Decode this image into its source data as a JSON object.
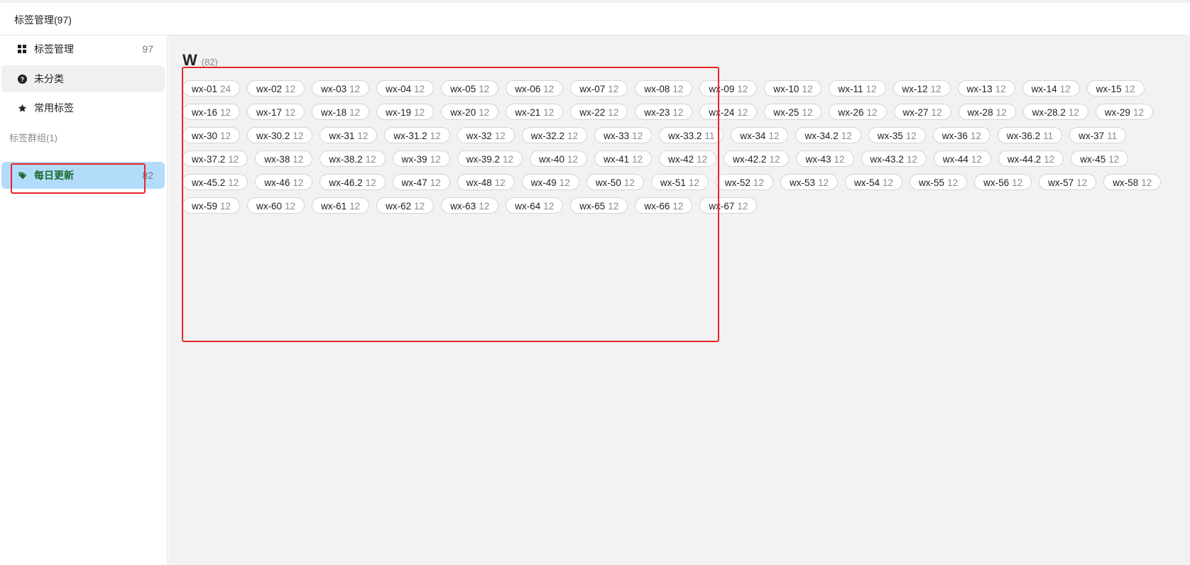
{
  "window": {
    "title": "标签管理(97)"
  },
  "sidebar": {
    "items": [
      {
        "label": "标签管理",
        "count": "97",
        "icon": "grid-icon"
      },
      {
        "label": "未分类",
        "count": "",
        "icon": "question-circle-icon"
      },
      {
        "label": "常用标签",
        "count": "",
        "icon": "star-icon"
      }
    ],
    "section_label": "标签群组(1)",
    "groups": [
      {
        "label": "每日更新",
        "count": "82",
        "icon": "tags-icon"
      }
    ]
  },
  "main": {
    "group_letter": "W",
    "group_count": "(82)",
    "tags": [
      {
        "name": "wx-01",
        "count": "24"
      },
      {
        "name": "wx-02",
        "count": "12"
      },
      {
        "name": "wx-03",
        "count": "12"
      },
      {
        "name": "wx-04",
        "count": "12"
      },
      {
        "name": "wx-05",
        "count": "12"
      },
      {
        "name": "wx-06",
        "count": "12"
      },
      {
        "name": "wx-07",
        "count": "12"
      },
      {
        "name": "wx-08",
        "count": "12"
      },
      {
        "name": "wx-09",
        "count": "12"
      },
      {
        "name": "wx-10",
        "count": "12"
      },
      {
        "name": "wx-11",
        "count": "12"
      },
      {
        "name": "wx-12",
        "count": "12"
      },
      {
        "name": "wx-13",
        "count": "12"
      },
      {
        "name": "wx-14",
        "count": "12"
      },
      {
        "name": "wx-15",
        "count": "12"
      },
      {
        "name": "wx-16",
        "count": "12"
      },
      {
        "name": "wx-17",
        "count": "12"
      },
      {
        "name": "wx-18",
        "count": "12"
      },
      {
        "name": "wx-19",
        "count": "12"
      },
      {
        "name": "wx-20",
        "count": "12"
      },
      {
        "name": "wx-21",
        "count": "12"
      },
      {
        "name": "wx-22",
        "count": "12"
      },
      {
        "name": "wx-23",
        "count": "12"
      },
      {
        "name": "wx-24",
        "count": "12"
      },
      {
        "name": "wx-25",
        "count": "12"
      },
      {
        "name": "wx-26",
        "count": "12"
      },
      {
        "name": "wx-27",
        "count": "12"
      },
      {
        "name": "wx-28",
        "count": "12"
      },
      {
        "name": "wx-28.2",
        "count": "12"
      },
      {
        "name": "wx-29",
        "count": "12"
      },
      {
        "name": "wx-30",
        "count": "12"
      },
      {
        "name": "wx-30.2",
        "count": "12"
      },
      {
        "name": "wx-31",
        "count": "12"
      },
      {
        "name": "wx-31.2",
        "count": "12"
      },
      {
        "name": "wx-32",
        "count": "12"
      },
      {
        "name": "wx-32.2",
        "count": "12"
      },
      {
        "name": "wx-33",
        "count": "12"
      },
      {
        "name": "wx-33.2",
        "count": "11"
      },
      {
        "name": "wx-34",
        "count": "12"
      },
      {
        "name": "wx-34.2",
        "count": "12"
      },
      {
        "name": "wx-35",
        "count": "12"
      },
      {
        "name": "wx-36",
        "count": "12"
      },
      {
        "name": "wx-36.2",
        "count": "11"
      },
      {
        "name": "wx-37",
        "count": "11"
      },
      {
        "name": "wx-37.2",
        "count": "12"
      },
      {
        "name": "wx-38",
        "count": "12"
      },
      {
        "name": "wx-38.2",
        "count": "12"
      },
      {
        "name": "wx-39",
        "count": "12"
      },
      {
        "name": "wx-39.2",
        "count": "12"
      },
      {
        "name": "wx-40",
        "count": "12"
      },
      {
        "name": "wx-41",
        "count": "12"
      },
      {
        "name": "wx-42",
        "count": "12"
      },
      {
        "name": "wx-42.2",
        "count": "12"
      },
      {
        "name": "wx-43",
        "count": "12"
      },
      {
        "name": "wx-43.2",
        "count": "12"
      },
      {
        "name": "wx-44",
        "count": "12"
      },
      {
        "name": "wx-44.2",
        "count": "12"
      },
      {
        "name": "wx-45",
        "count": "12"
      },
      {
        "name": "wx-45.2",
        "count": "12"
      },
      {
        "name": "wx-46",
        "count": "12"
      },
      {
        "name": "wx-46.2",
        "count": "12"
      },
      {
        "name": "wx-47",
        "count": "12"
      },
      {
        "name": "wx-48",
        "count": "12"
      },
      {
        "name": "wx-49",
        "count": "12"
      },
      {
        "name": "wx-50",
        "count": "12"
      },
      {
        "name": "wx-51",
        "count": "12"
      },
      {
        "name": "wx-52",
        "count": "12"
      },
      {
        "name": "wx-53",
        "count": "12"
      },
      {
        "name": "wx-54",
        "count": "12"
      },
      {
        "name": "wx-55",
        "count": "12"
      },
      {
        "name": "wx-56",
        "count": "12"
      },
      {
        "name": "wx-57",
        "count": "12"
      },
      {
        "name": "wx-58",
        "count": "12"
      },
      {
        "name": "wx-59",
        "count": "12"
      },
      {
        "name": "wx-60",
        "count": "12"
      },
      {
        "name": "wx-61",
        "count": "12"
      },
      {
        "name": "wx-62",
        "count": "12"
      },
      {
        "name": "wx-63",
        "count": "12"
      },
      {
        "name": "wx-64",
        "count": "12"
      },
      {
        "name": "wx-65",
        "count": "12"
      },
      {
        "name": "wx-66",
        "count": "12"
      },
      {
        "name": "wx-67",
        "count": "12"
      }
    ]
  },
  "colors": {
    "active_bg": "#b3dcfb",
    "active_text": "#1a6b2a",
    "annotation": "#e8242b",
    "main_bg": "#f2f2f2"
  }
}
